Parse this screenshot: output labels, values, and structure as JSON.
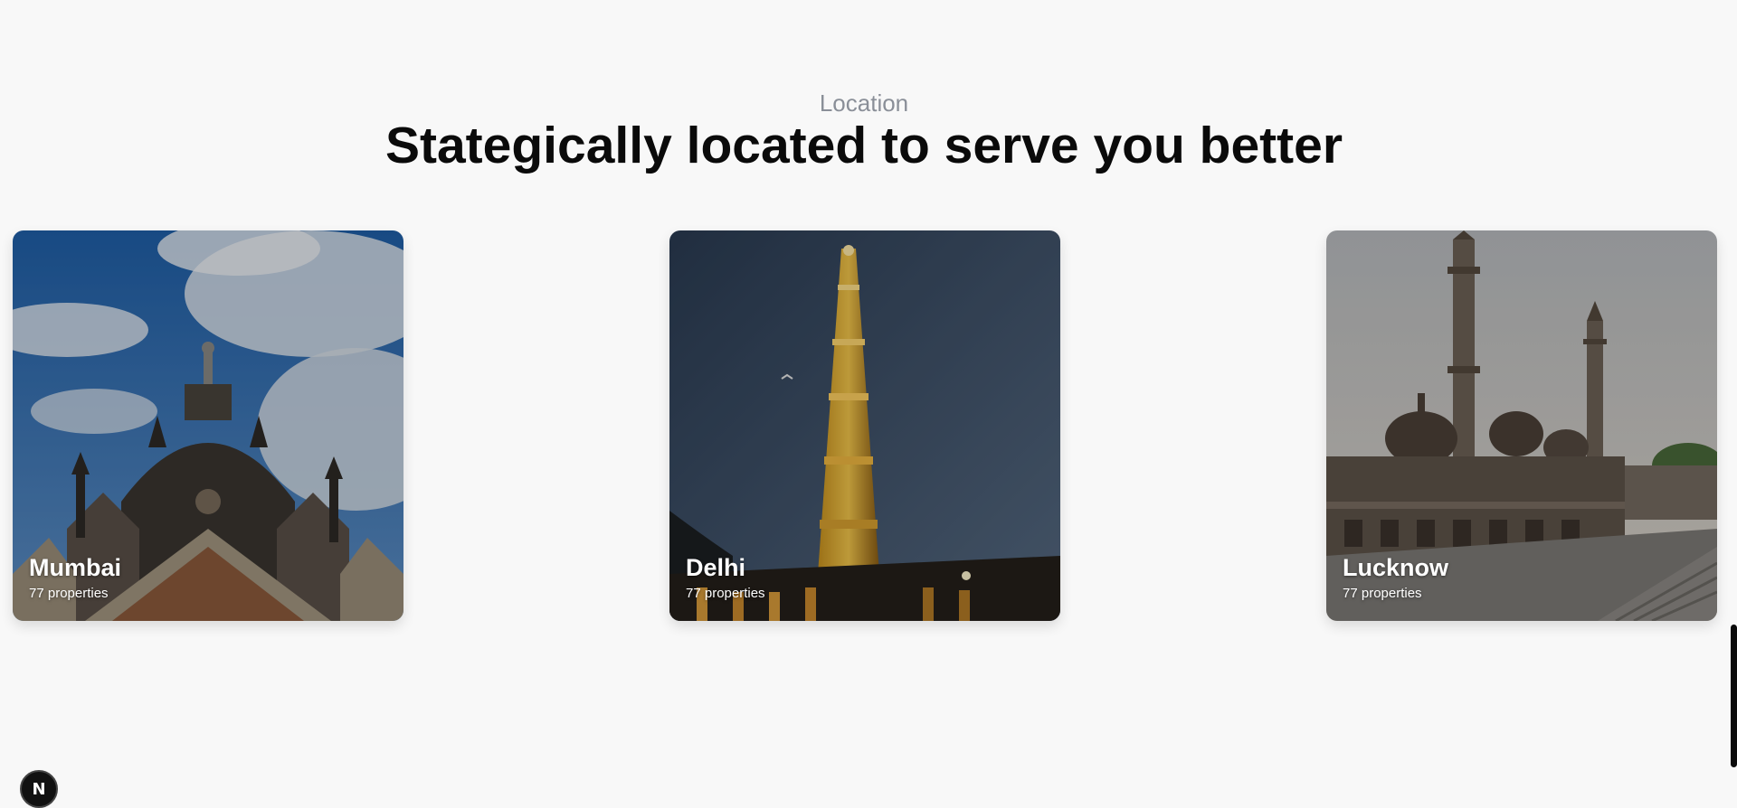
{
  "section": {
    "eyebrow": "Location",
    "title": "Stategically located to serve you better"
  },
  "locations": [
    {
      "city": "Mumbai",
      "count": "77 properties"
    },
    {
      "city": "Delhi",
      "count": "77 properties"
    },
    {
      "city": "Lucknow",
      "count": "77 properties"
    }
  ],
  "dev_badge": {
    "label": "N"
  },
  "colors": {
    "background": "#f8f8f8",
    "eyebrow": "#8a8f98",
    "title": "#0a0a0a",
    "card_text": "#ffffff"
  }
}
